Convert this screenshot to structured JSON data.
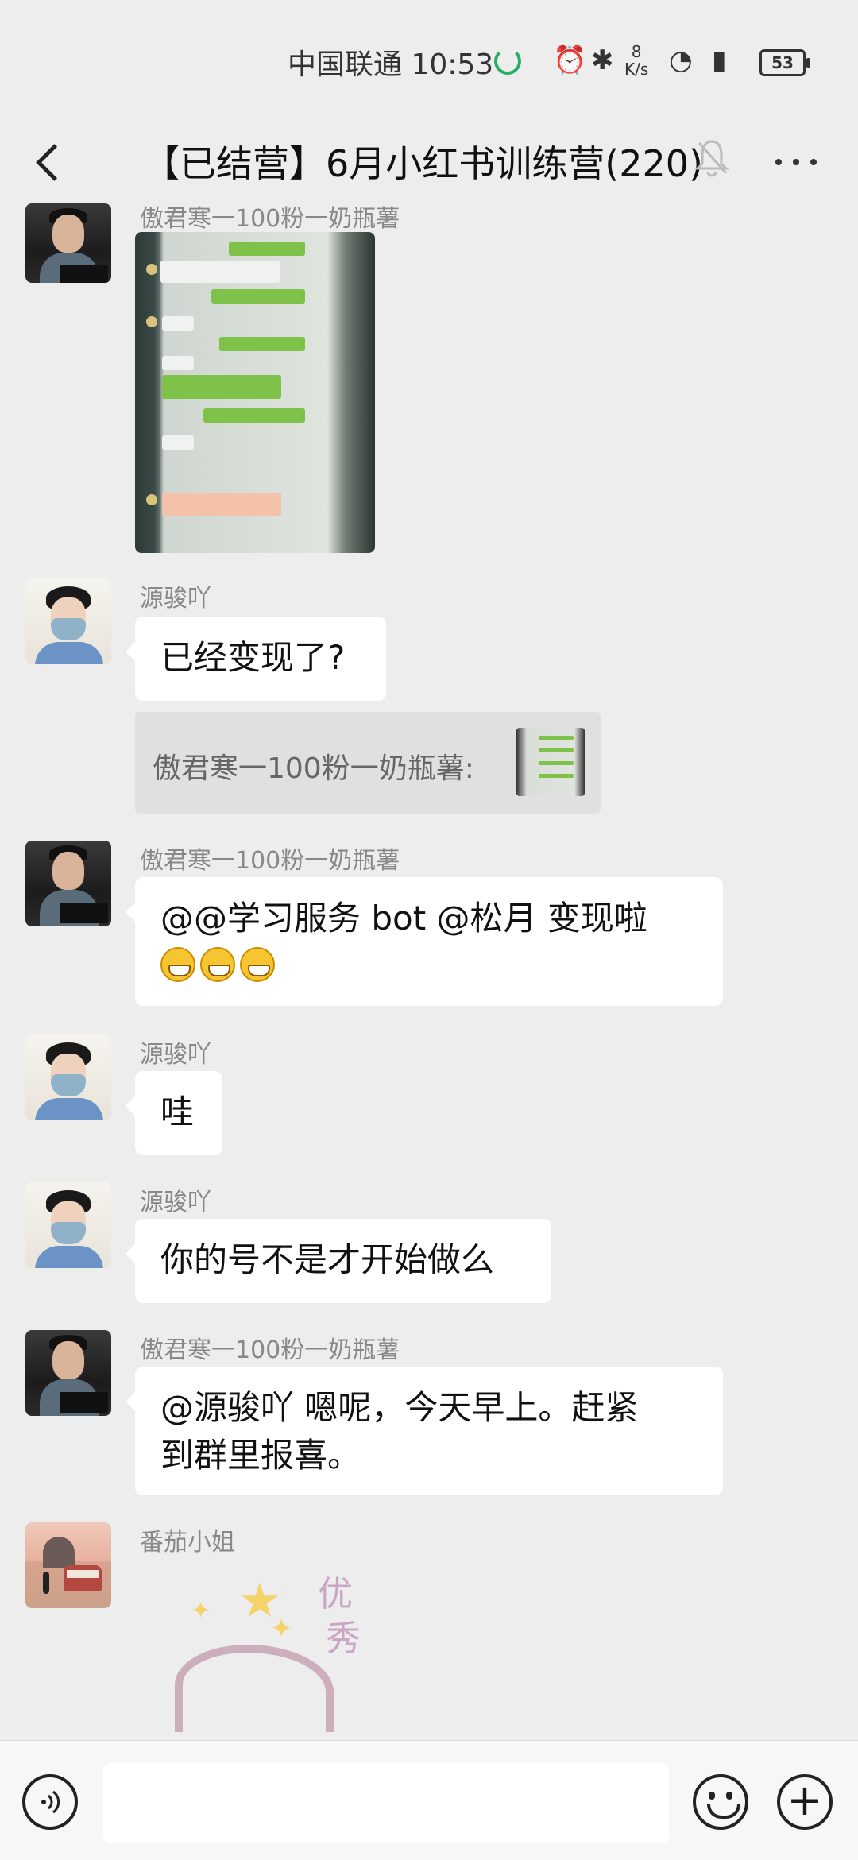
{
  "status_bar": {
    "carrier": "中国联通",
    "time": "10:53",
    "net_speed_value": "8",
    "net_speed_unit": "K/s",
    "battery": "53",
    "icons": [
      "alarm-icon",
      "bluetooth-icon",
      "wifi-icon",
      "signal-icon"
    ]
  },
  "header": {
    "title": "【已结营】6月小红书训练营(220)",
    "muted": true
  },
  "messages": [
    {
      "sender": "傲君寒一100粉一奶瓶薯",
      "type": "image"
    },
    {
      "sender": "源骏吖",
      "text": "已经变现了?",
      "quote": "傲君寒一100粉一奶瓶薯:"
    },
    {
      "sender": "傲君寒一100粉一奶瓶薯",
      "text_line1": "@@学习服务 bot @松月   变现啦"
    },
    {
      "sender": "源骏吖",
      "text": "哇"
    },
    {
      "sender": "源骏吖",
      "text": "你的号不是才开始做么"
    },
    {
      "sender": "傲君寒一100粉一奶瓶薯",
      "text_line1": "@源骏吖   嗯呢，今天早上。赶紧",
      "text_line2": "到群里报喜。"
    },
    {
      "sender": "番茄小姐",
      "type": "sticker",
      "sticker_text1": "优",
      "sticker_text2": "秀"
    }
  ],
  "input_bar": {
    "placeholder": ""
  },
  "colors": {
    "background": "#ededed",
    "bubble": "#ffffff",
    "accent_green": "#2aae67"
  }
}
